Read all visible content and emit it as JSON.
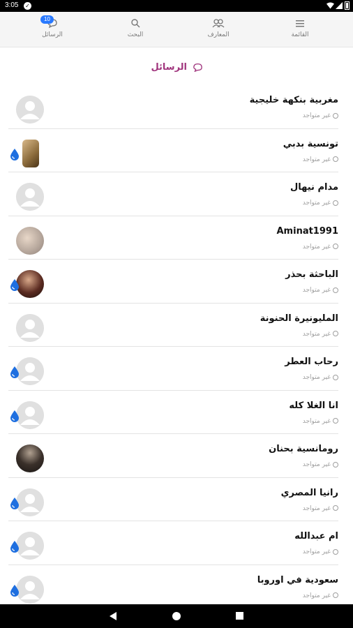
{
  "statusbar": {
    "time": "3:05"
  },
  "nav": {
    "tabs": [
      {
        "label": "القائمة",
        "icon": "menu-icon"
      },
      {
        "label": "المعارف",
        "icon": "contacts-icon"
      },
      {
        "label": "البحث",
        "icon": "search-icon"
      },
      {
        "label": "الرسائل",
        "icon": "chat-icon",
        "badge": "10"
      }
    ]
  },
  "section": {
    "title": "الرسائل"
  },
  "status_text": "غير متواجد",
  "conversations": [
    {
      "name": "مغربية بنكهة خليجية",
      "status": "غير متواجد",
      "avatar": "placeholder",
      "drop": false
    },
    {
      "name": "تونسية بدبي",
      "status": "غير متواجد",
      "avatar": "photo",
      "drop": true
    },
    {
      "name": "مدام نيهال",
      "status": "غير متواجد",
      "avatar": "placeholder",
      "drop": false
    },
    {
      "name": "Aminat1991",
      "status": "غير متواجد",
      "avatar": "photo",
      "drop": false
    },
    {
      "name": "الباحثة بحذر",
      "status": "غير متواجد",
      "avatar": "photo",
      "drop": true
    },
    {
      "name": "المليونيرة الحنونة",
      "status": "غير متواجد",
      "avatar": "placeholder",
      "drop": false
    },
    {
      "name": "رحاب العطر",
      "status": "غير متواجد",
      "avatar": "placeholder",
      "drop": true
    },
    {
      "name": "انا الغلا كله",
      "status": "غير متواجد",
      "avatar": "placeholder",
      "drop": true
    },
    {
      "name": "رومانسية بحنان",
      "status": "غير متواجد",
      "avatar": "photo",
      "drop": false
    },
    {
      "name": "رانيا المصري",
      "status": "غير متواجد",
      "avatar": "placeholder",
      "drop": true
    },
    {
      "name": "ام عبدالله",
      "status": "غير متواجد",
      "avatar": "placeholder",
      "drop": true
    },
    {
      "name": "سعودية في اوروبا",
      "status": "غير متواجد",
      "avatar": "placeholder",
      "drop": true
    }
  ],
  "colors": {
    "accent": "#a0357d",
    "badge": "#2979ff",
    "drop": "#1e6fe0"
  }
}
